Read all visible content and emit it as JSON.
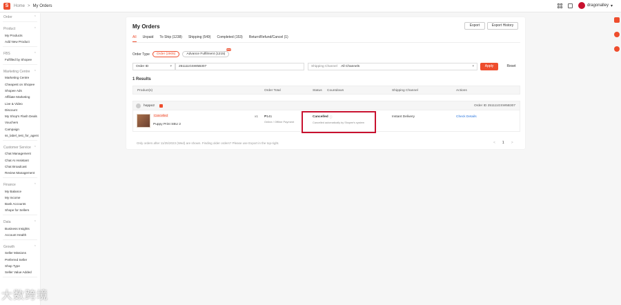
{
  "breadcrumb": {
    "home": "Home",
    "separator": ">",
    "current": "My Orders"
  },
  "user": {
    "name": "dragonalley"
  },
  "sidebar": [
    {
      "title": "Order",
      "items": []
    },
    {
      "title": "Product",
      "items": [
        "My Products",
        "Add New Product"
      ]
    },
    {
      "title": "FBS",
      "items": [
        "Fulfilled by Shopee"
      ]
    },
    {
      "title": "Marketing Centre",
      "items": [
        "Marketing Centre",
        "Cheapest on Shopee",
        "Shopee Ads",
        "Affiliate Marketing",
        "Live & Video",
        "Discount",
        "My Shop's Flash Deals",
        "Vouchers",
        "Campaign",
        "ss_label_test_for_agent"
      ]
    },
    {
      "title": "Customer Service",
      "items": [
        "Chat Management",
        "Chat AI Assistant",
        "Chat Broadcast",
        "Review Management"
      ]
    },
    {
      "title": "Finance",
      "items": [
        "My Balance",
        "My Income",
        "Bank Accounts",
        "Shope for Sellers"
      ]
    },
    {
      "title": "Data",
      "items": [
        "Business Insights",
        "Account Health"
      ]
    },
    {
      "title": "Growth",
      "items": [
        "Seller Missions",
        "Preferred Seller",
        "Shop Type",
        "Seller Value Added"
      ]
    }
  ],
  "page": {
    "title": "My Orders",
    "export_label": "Export",
    "export_history_label": "Export History",
    "tabs": [
      "All",
      "Unpaid",
      "To Ship (1238)",
      "Shipping (549)",
      "Completed (153)",
      "Return/Refund/Cancel (1)"
    ],
    "order_type_label": "Order Type",
    "order_type_options": [
      "Order (2905)",
      "Advance Fulfilment (1215)"
    ],
    "new_badge": "new",
    "filter": {
      "field": "Order ID",
      "value": "251111GSW5B307",
      "channel_label": "Shipping Channel",
      "channel_value": "All Channels"
    },
    "apply_label": "Apply",
    "reset_label": "Reset",
    "results": "1 Results",
    "columns": [
      "Product(s)",
      "Order Total",
      "Status",
      "Countdown",
      "Shipping Channel",
      "Actions"
    ],
    "shop": {
      "name": "hoppo2",
      "order_id": "Order ID 251111GSW5B307"
    },
    "order": {
      "tag": "Cancelled",
      "product": "Puppy Print SBU 2",
      "qty": "x1",
      "total": "₱141",
      "payment": "Online / Offline Payment",
      "status": "Cancelled",
      "status_note": "Cancelled automatically by Shopee's system",
      "shipping": "Instant Delivery",
      "action": "Check Details"
    },
    "footnote": "Only orders after 11/25/2023 (Wed) are shown. Finding older orders? Please use Export in the top-right.",
    "pager": {
      "prev": "<",
      "page": "1",
      "next": ">"
    }
  },
  "watermark": "大数跨境"
}
